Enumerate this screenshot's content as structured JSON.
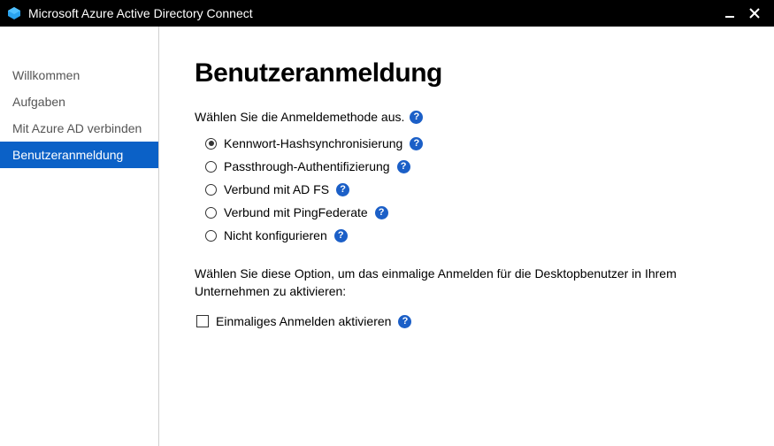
{
  "window": {
    "title": "Microsoft Azure Active Directory Connect"
  },
  "sidebar": {
    "items": [
      {
        "label": "Willkommen",
        "state": "done"
      },
      {
        "label": "Aufgaben",
        "state": "done"
      },
      {
        "label": "Mit Azure AD verbinden",
        "state": "done"
      },
      {
        "label": "Benutzeranmeldung",
        "state": "active"
      }
    ]
  },
  "main": {
    "heading": "Benutzeranmeldung",
    "select_method_label": "Wählen Sie die Anmeldemethode aus.",
    "options": [
      {
        "label": "Kennwort-Hashsynchronisierung",
        "selected": true
      },
      {
        "label": "Passthrough-Authentifizierung",
        "selected": false
      },
      {
        "label": "Verbund mit AD FS",
        "selected": false
      },
      {
        "label": "Verbund mit PingFederate",
        "selected": false
      },
      {
        "label": "Nicht konfigurieren",
        "selected": false
      }
    ],
    "sso_description": "Wählen Sie diese Option, um das einmalige Anmelden für die Desktopbenutzer in Ihrem Unternehmen zu aktivieren:",
    "sso_checkbox_label": "Einmaliges Anmelden aktivieren",
    "sso_checked": false
  }
}
